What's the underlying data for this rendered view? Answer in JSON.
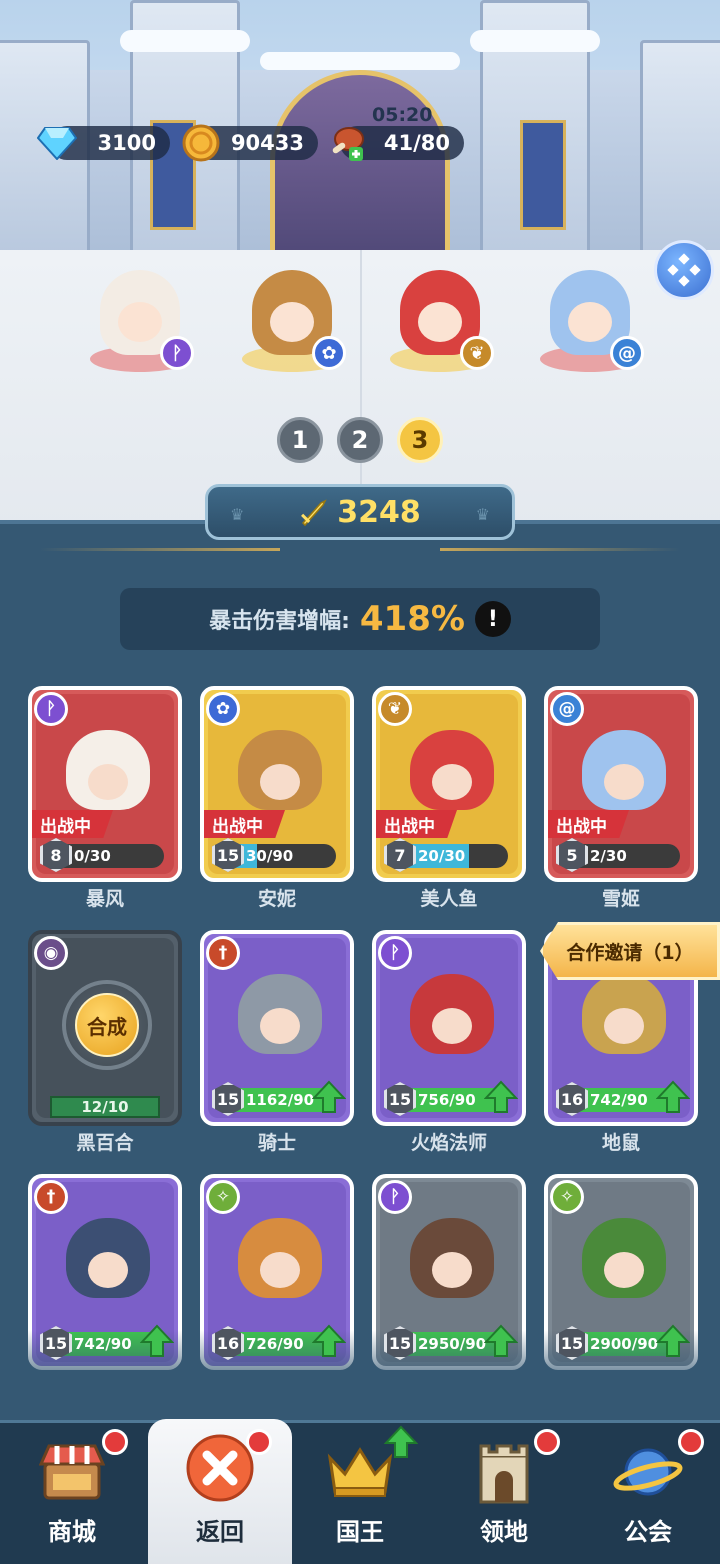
{
  "resources": {
    "gems": "3100",
    "coins": "90433",
    "stamina": "41/80",
    "stamina_timer": "05:20"
  },
  "pages": [
    "1",
    "2",
    "3"
  ],
  "active_page": "3",
  "power": "3248",
  "stat": {
    "label": "暴击伤害增幅:",
    "value": "418%",
    "info": "!"
  },
  "merge_label": "合成",
  "invite_label": "合作邀请（1）",
  "cards": [
    {
      "name": "暴风",
      "level": "8",
      "progress": "0/30",
      "fill": 0.0,
      "status": "出战中",
      "elem_icon": "staff-icon",
      "color": "red"
    },
    {
      "name": "安妮",
      "level": "15",
      "progress": "30/90",
      "fill": 0.33,
      "status": "出战中",
      "elem_icon": "paw-icon",
      "color": "yellow"
    },
    {
      "name": "美人鱼",
      "level": "7",
      "progress": "20/30",
      "fill": 0.67,
      "status": "出战中",
      "elem_icon": "wing-icon",
      "color": "yellow"
    },
    {
      "name": "雪姬",
      "level": "5",
      "progress": "2/30",
      "fill": 0.07,
      "status": "出战中",
      "elem_icon": "swirl-icon",
      "color": "red"
    },
    {
      "name": "黑百合",
      "level": "",
      "progress": "12/10",
      "fill": 1.0,
      "status": "",
      "elem_icon": "eye-icon",
      "color": "dark"
    },
    {
      "name": "骑士",
      "level": "15",
      "progress": "1162/90",
      "fill": 1.0,
      "status": "",
      "elem_icon": "sword-icon",
      "color": "purple"
    },
    {
      "name": "火焰法师",
      "level": "15",
      "progress": "756/90",
      "fill": 1.0,
      "status": "",
      "elem_icon": "staff-icon",
      "color": "purple"
    },
    {
      "name": "地鼠",
      "level": "16",
      "progress": "742/90",
      "fill": 1.0,
      "status": "",
      "elem_icon": "swirl-icon",
      "color": "purple"
    },
    {
      "name": "",
      "level": "15",
      "progress": "742/90",
      "fill": 1.0,
      "status": "",
      "elem_icon": "sword-icon",
      "color": "purple"
    },
    {
      "name": "",
      "level": "16",
      "progress": "726/90",
      "fill": 1.0,
      "status": "",
      "elem_icon": "bow-icon",
      "color": "purple"
    },
    {
      "name": "",
      "level": "15",
      "progress": "2950/90",
      "fill": 1.0,
      "status": "",
      "elem_icon": "staff-icon",
      "color": "grey"
    },
    {
      "name": "",
      "level": "15",
      "progress": "2900/90",
      "fill": 1.0,
      "status": "",
      "elem_icon": "bow-icon",
      "color": "grey"
    }
  ],
  "nav": [
    {
      "label": "商城",
      "icon": "shop-icon",
      "badge": "dot"
    },
    {
      "label": "返回",
      "icon": "close-icon",
      "badge": "dot"
    },
    {
      "label": "国王",
      "icon": "crown-icon",
      "badge": "arrow"
    },
    {
      "label": "领地",
      "icon": "castle-icon",
      "badge": "dot"
    },
    {
      "label": "公会",
      "icon": "planet-icon",
      "badge": "dot"
    }
  ],
  "colors": {
    "gold": "#f7b942",
    "power": "#ffe066",
    "panel": "#355873",
    "upgrade_green": "#3fc24f",
    "badge_red": "#e33b3b"
  }
}
